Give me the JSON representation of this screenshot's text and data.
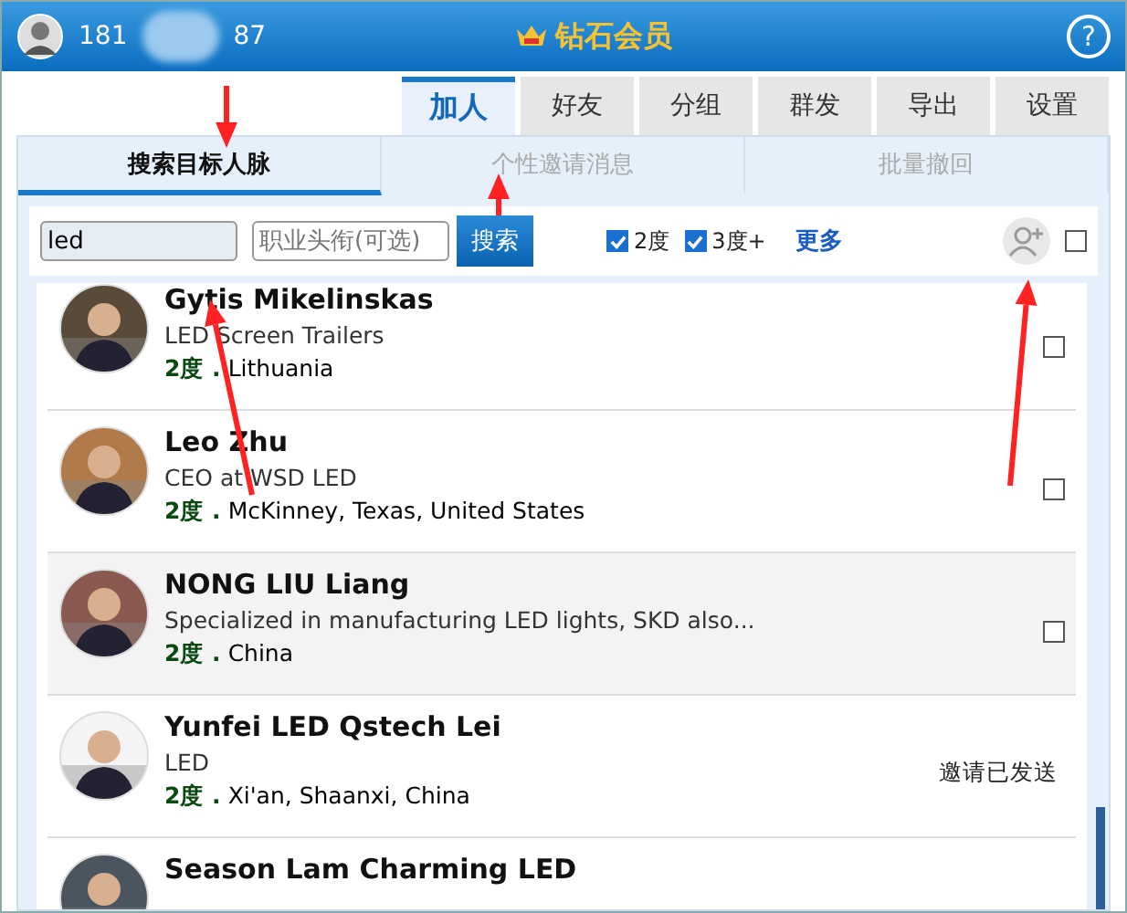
{
  "header": {
    "account_prefix": "181",
    "account_suffix": "87",
    "membership": "钻石会员",
    "help": "?"
  },
  "tabs": [
    {
      "label": "加人",
      "selected": true
    },
    {
      "label": "好友",
      "selected": false
    },
    {
      "label": "分组",
      "selected": false
    },
    {
      "label": "群发",
      "selected": false
    },
    {
      "label": "导出",
      "selected": false
    },
    {
      "label": "设置",
      "selected": false
    }
  ],
  "subtabs": [
    {
      "label": "搜索目标人脉",
      "selected": true
    },
    {
      "label": "个性邀请消息",
      "selected": false
    },
    {
      "label": "批量撤回",
      "selected": false
    }
  ],
  "search": {
    "keyword": "led",
    "title_placeholder": "职业头衔(可选)",
    "button": "搜索",
    "filters": [
      {
        "label": "2度",
        "checked": true
      },
      {
        "label": "3度+",
        "checked": true
      }
    ],
    "more": "更多",
    "select_all_checked": false
  },
  "results": [
    {
      "name": "Gytis Mikelinskas",
      "headline": "LED Screen Trailers",
      "degree": "2度 .",
      "location": "Lithuania",
      "kind": "checkbox",
      "checked": false,
      "highlighted": false
    },
    {
      "name": "Leo Zhu",
      "headline": "CEO at WSD LED",
      "degree": "2度 .",
      "location": "McKinney, Texas, United States",
      "kind": "checkbox",
      "checked": false,
      "highlighted": false
    },
    {
      "name": "NONG LIU Liang",
      "headline": "Specialized in manufacturing LED lights, SKD also...",
      "degree": "2度 .",
      "location": "China",
      "kind": "checkbox",
      "checked": false,
      "highlighted": true
    },
    {
      "name": "Yunfei LED Qstech Lei",
      "headline": "LED",
      "degree": "2度 .",
      "location": "Xi'an, Shaanxi, China",
      "kind": "status",
      "status": "邀请已发送",
      "highlighted": false
    },
    {
      "name": "Season Lam Charming LED",
      "kind": "cut",
      "highlighted": false
    }
  ]
}
